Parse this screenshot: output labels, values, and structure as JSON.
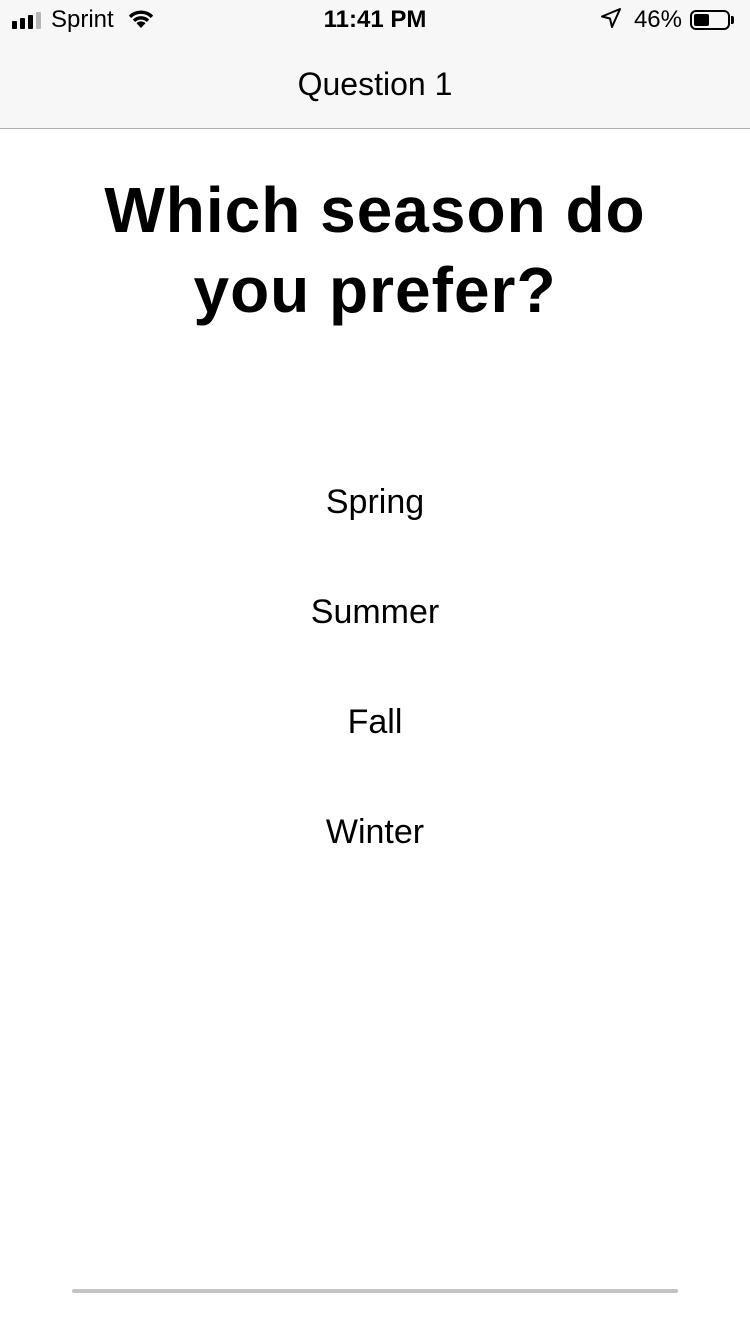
{
  "status_bar": {
    "carrier": "Sprint",
    "time": "11:41 PM",
    "battery_percent": "46%",
    "battery_level": 0.46,
    "signal_bars_filled": 3,
    "signal_bars_total": 4,
    "icons": [
      "signal-icon",
      "wifi-icon",
      "location-arrow-icon",
      "battery-icon"
    ]
  },
  "nav": {
    "title": "Question 1"
  },
  "question": {
    "text": "Which season do you prefer?"
  },
  "options": [
    {
      "label": "Spring"
    },
    {
      "label": "Summer"
    },
    {
      "label": "Fall"
    },
    {
      "label": "Winter"
    }
  ]
}
